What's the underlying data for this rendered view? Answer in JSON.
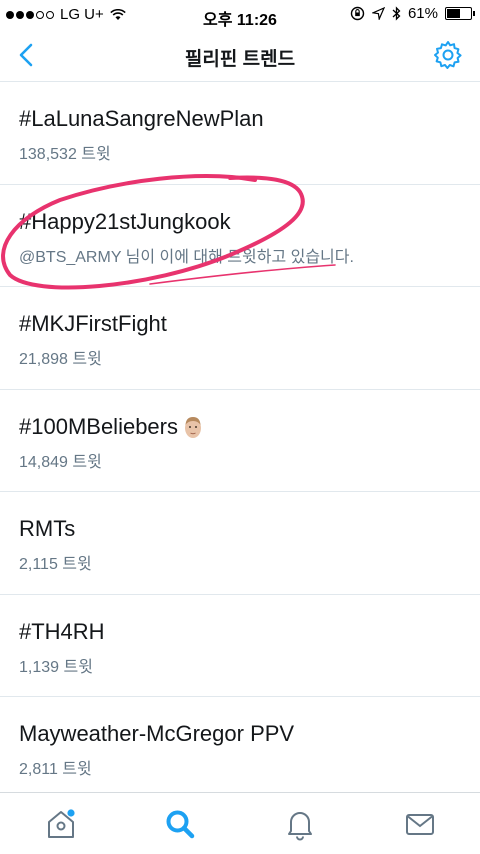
{
  "status_bar": {
    "carrier": "LG U+",
    "time": "오후 11:26",
    "battery_percent": "61%",
    "battery_level": 0.61
  },
  "nav": {
    "title": "필리핀 트렌드",
    "accent_color": "#1da1f2"
  },
  "trends": [
    {
      "name": "#LaLunaSangreNewPlan",
      "subtitle": "138,532 트윗"
    },
    {
      "name": "#Happy21stJungkook",
      "subtitle": "@BTS_ARMY 님이 이에 대해 트윗하고 있습니다."
    },
    {
      "name": "#MKJFirstFight",
      "subtitle": "21,898 트윗"
    },
    {
      "name": "#100MBeliebers",
      "subtitle": "14,849 트윗",
      "emoji": "face-emoji"
    },
    {
      "name": "RMTs",
      "subtitle": "2,115 트윗"
    },
    {
      "name": "#TH4RH",
      "subtitle": "1,139 트윗"
    },
    {
      "name": "Mayweather-McGregor PPV",
      "subtitle": "2,811 트윗"
    }
  ],
  "tab_bar": {
    "items": [
      "home-icon",
      "search-icon",
      "bell-icon",
      "mail-icon"
    ],
    "active": "search-icon",
    "active_color": "#1da1f2",
    "inactive_color": "#657786"
  },
  "annotation_color": "#e8336e"
}
